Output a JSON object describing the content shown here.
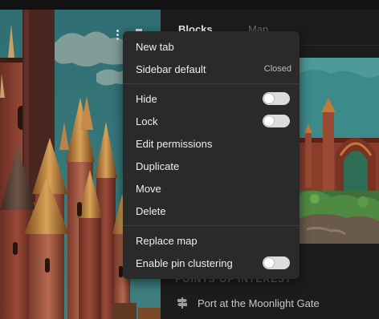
{
  "panel": {
    "tabs": [
      {
        "label": "Blocks",
        "active": true
      },
      {
        "label": "Map",
        "active": false
      }
    ],
    "section_title": "POINTS OF INTEREST",
    "points_of_interest": [
      {
        "label": "Port at the Moonlight Gate",
        "icon": "signpost-icon"
      }
    ]
  },
  "menu": {
    "items": [
      {
        "label": "New tab"
      },
      {
        "label": "Sidebar default",
        "value": "Closed"
      },
      {
        "label": "Hide",
        "toggle": false
      },
      {
        "label": "Lock",
        "toggle": false
      },
      {
        "label": "Edit permissions"
      },
      {
        "label": "Duplicate"
      },
      {
        "label": "Move"
      },
      {
        "label": "Delete"
      },
      {
        "label": "Replace map"
      },
      {
        "label": "Enable pin clustering",
        "toggle": false
      }
    ]
  },
  "colors": {
    "menu_bg": "#2a2a2a",
    "panel_bg": "#1c1c1c",
    "toggle_off": "#dcdcdc"
  }
}
